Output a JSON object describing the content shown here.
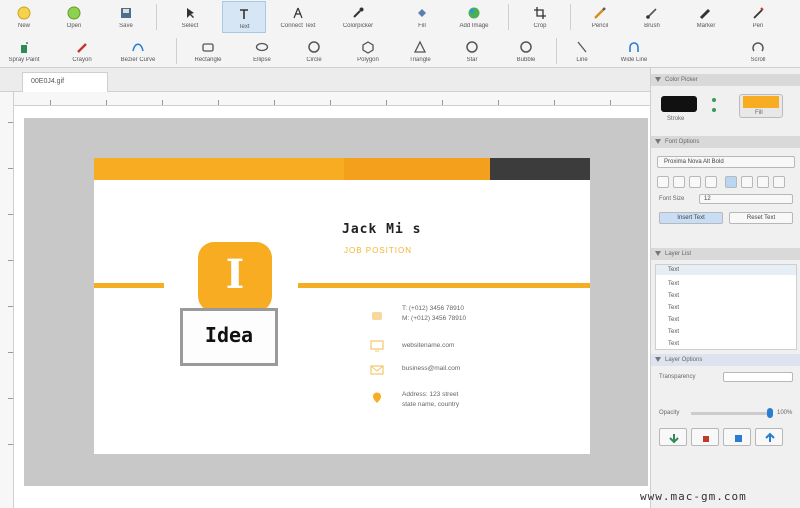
{
  "toolbar": {
    "row1": [
      "New",
      "Open",
      "Save",
      "Select",
      "Text",
      "Connect Text",
      "Colorpicker",
      "Fill",
      "Add Image",
      "Crop",
      "Pencil",
      "Brush",
      "Marker",
      "Pen"
    ],
    "row2": [
      "Spray Paint",
      "Crayon",
      "Bezier Curve",
      "Rectangle",
      "Ellipse",
      "Circle",
      "Polygon",
      "Triangle",
      "Star",
      "Bubble",
      "Line",
      "Wide Line",
      "Scroll"
    ]
  },
  "tabs": {
    "doc_name": "00E0J4.gif"
  },
  "card": {
    "name": "Jack Mi  s",
    "position": "JOB POSITION",
    "logo_letter": "I",
    "idea_text": "Idea",
    "phone1": "T: (+012) 3456 78910",
    "phone2": "M: (+012) 3456 78910",
    "website": "websitename.com",
    "email": "business@mail.com",
    "address1": "Address: 123 street",
    "address2": "state name, country",
    "colors": {
      "accent": "#f7ac22",
      "stripe_mid": "#f4a01c",
      "stripe_dark": "#3c3c3c"
    }
  },
  "panel": {
    "color_picker_title": "Color Picker",
    "color_label_left": "Stroke",
    "color_label_right": "Fill",
    "font_title": "Font Options",
    "font_name": "Proxima Nova Alt Bold",
    "size_label": "Font Size",
    "size_value": "12",
    "insert_text_button": "Insert Text",
    "reset_text_button": "Reset Text",
    "layer_title": "Layer List",
    "layer_first": "Text",
    "layers": [
      "Text",
      "Text",
      "Text",
      "Text",
      "Text",
      "Text"
    ],
    "layer_options_title": "Layer Options",
    "transparency_label": "Transparency",
    "opacity_label": "Opacity",
    "opacity_value": "100%"
  },
  "watermark": "www.mac-gm.com"
}
